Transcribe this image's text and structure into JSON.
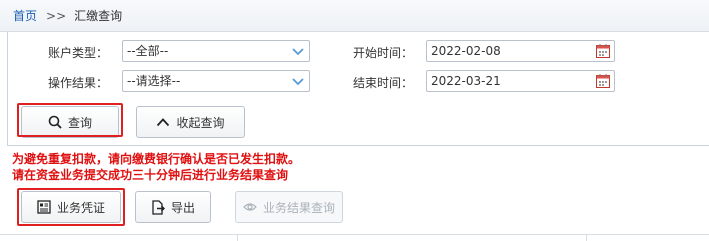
{
  "breadcrumb": {
    "home": "首页",
    "separator": ">>",
    "current": "汇缴查询"
  },
  "form": {
    "account_type_label": "账户类型：",
    "account_type_value": "--全部--",
    "op_result_label": "操作结果：",
    "op_result_value": "--请选择--",
    "start_label": "开始时间：",
    "start_value": "2022-02-08",
    "end_label": "结束时间：",
    "end_value": "2022-03-21"
  },
  "buttons": {
    "query": "查询",
    "collapse": "收起查询",
    "voucher": "业务凭证",
    "export": "导出",
    "result_query": "业务结果查询"
  },
  "warnings": {
    "line1": "为避免重复扣款，请向缴费银行确认是否已发生扣款。",
    "line2": "请在资金业务提交成功三十分钟后进行业务结果查询"
  },
  "colors": {
    "highlight": "#e02020",
    "warning": "#e01010",
    "link": "#1a5fb4"
  }
}
